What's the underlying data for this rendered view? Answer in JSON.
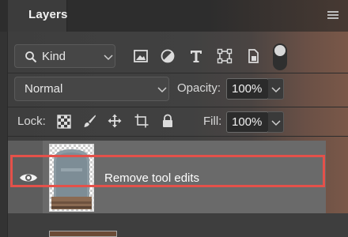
{
  "panel": {
    "tab_label": "Layers",
    "menu_icon": "panel-menu-icon"
  },
  "filter": {
    "kind_label": "Kind",
    "kind_icon": "search-icon",
    "filter_icons": [
      "image-filter-icon",
      "adjustment-filter-icon",
      "type-filter-icon",
      "shape-filter-icon",
      "smart-object-filter-icon"
    ],
    "toggle_on": true
  },
  "blend": {
    "mode": "Normal",
    "opacity_label": "Opacity:",
    "opacity_value": "100%",
    "fill_label": "Fill:",
    "fill_value": "100%"
  },
  "lock": {
    "label": "Lock:",
    "icons": [
      "lock-transparent-pixels-icon",
      "lock-image-pixels-icon",
      "lock-position-icon",
      "lock-artboard-icon",
      "lock-all-icon"
    ]
  },
  "layers": [
    {
      "name": "Remove tool edits",
      "visible": true,
      "selected": true,
      "highlighted": true
    }
  ],
  "colors": {
    "highlight": "#e4514a",
    "selected_row": "#6a6a6a",
    "panel_bg": "#3e3e3e"
  }
}
